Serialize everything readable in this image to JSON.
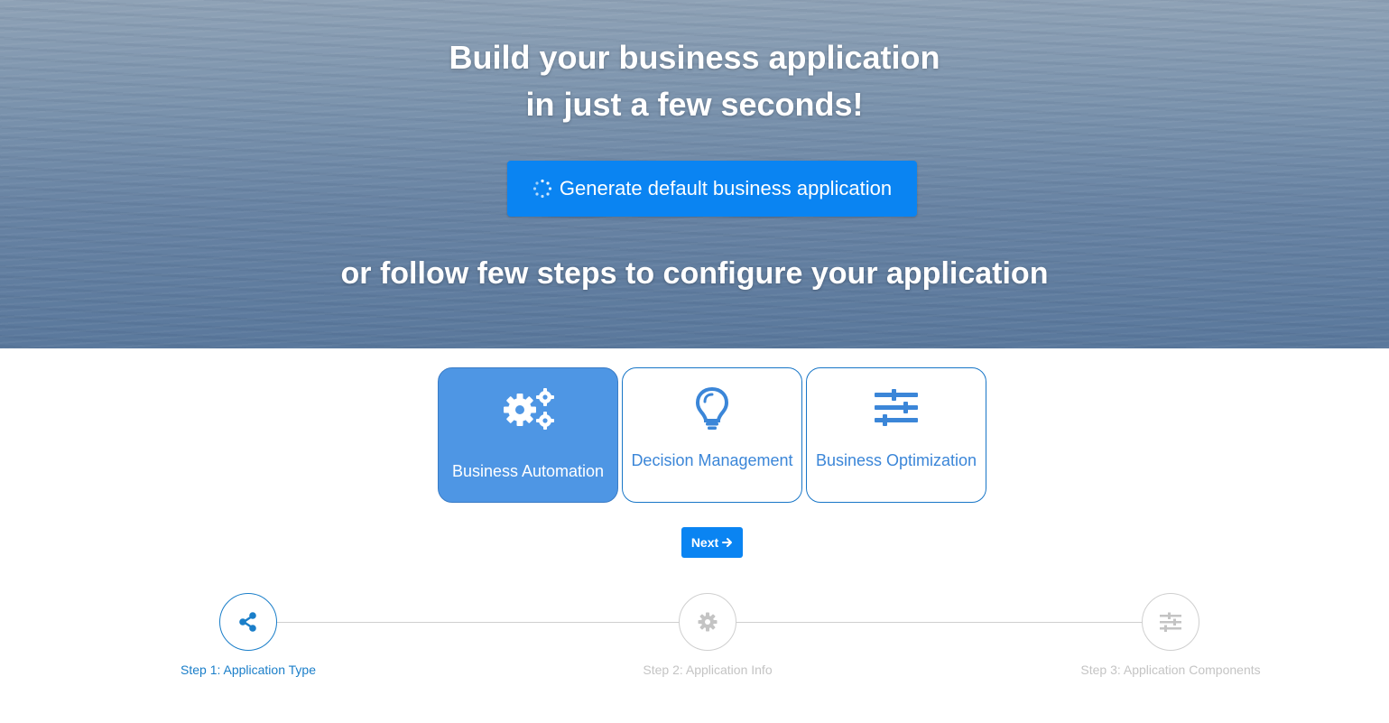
{
  "hero": {
    "title_line1": "Build your business application",
    "title_line2": "in just a few seconds!",
    "generate_button_label": "Generate default business application",
    "subtitle": "or follow few steps to configure your application"
  },
  "app_types": [
    {
      "label": "Business Automation",
      "icon": "gears-icon",
      "selected": true
    },
    {
      "label": "Decision Management",
      "icon": "lightbulb-icon",
      "selected": false
    },
    {
      "label": "Business Optimization",
      "icon": "sliders-icon",
      "selected": false
    }
  ],
  "next_button_label": "Next",
  "steps": [
    {
      "label": "Step 1: Application Type",
      "icon": "share-icon",
      "current": true
    },
    {
      "label": "Step 2: Application Info",
      "icon": "gear-icon",
      "current": false
    },
    {
      "label": "Step 3: Application Components",
      "icon": "sliders-icon",
      "current": false
    }
  ],
  "colors": {
    "primary": "#0a84f2",
    "card_selected": "#4e96e4",
    "card_text": "#3b86d8",
    "step_active": "#1a7ec9",
    "step_inactive": "#c4c4c4"
  }
}
